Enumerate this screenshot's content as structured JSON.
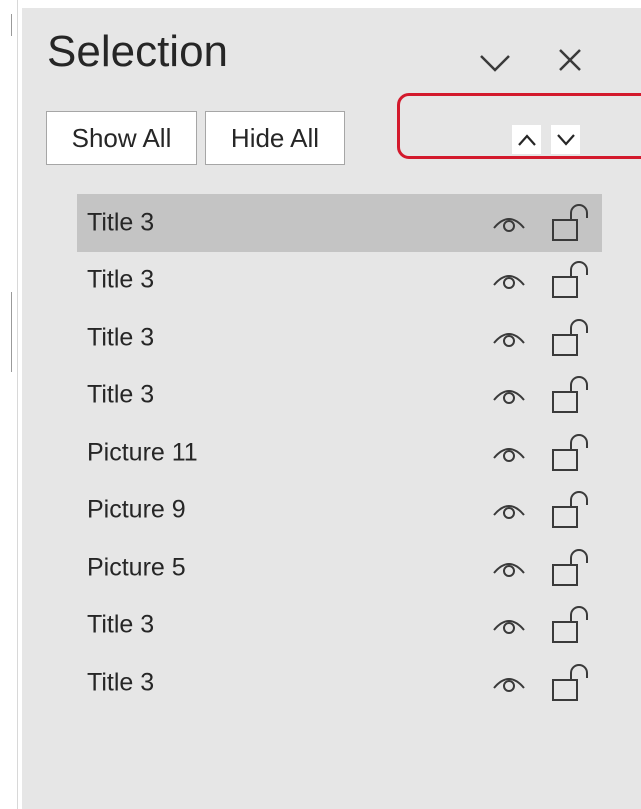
{
  "pane": {
    "title": "Selection",
    "options_icon": "chevron-down-icon",
    "close_icon": "close-icon"
  },
  "toolbar": {
    "show_all_label": "Show All",
    "hide_all_label": "Hide All",
    "bring_forward_icon": "chevron-up-icon",
    "send_backward_icon": "chevron-down-icon"
  },
  "annotation": {
    "highlight_color": "#d3192c"
  },
  "items": [
    {
      "label": "Title 3",
      "selected": true,
      "visible": true,
      "locked": false
    },
    {
      "label": "Title 3",
      "selected": false,
      "visible": true,
      "locked": false
    },
    {
      "label": "Title 3",
      "selected": false,
      "visible": true,
      "locked": false
    },
    {
      "label": "Title 3",
      "selected": false,
      "visible": true,
      "locked": false
    },
    {
      "label": "Picture 11",
      "selected": false,
      "visible": true,
      "locked": false
    },
    {
      "label": "Picture 9",
      "selected": false,
      "visible": true,
      "locked": false
    },
    {
      "label": "Picture 5",
      "selected": false,
      "visible": true,
      "locked": false
    },
    {
      "label": "Title 3",
      "selected": false,
      "visible": true,
      "locked": false
    },
    {
      "label": "Title 3",
      "selected": false,
      "visible": true,
      "locked": false
    }
  ],
  "colors": {
    "pane_background": "#e6e6e6",
    "selected_row": "#c4c4c4",
    "text": "#262626",
    "icon": "#3a3a3a"
  }
}
